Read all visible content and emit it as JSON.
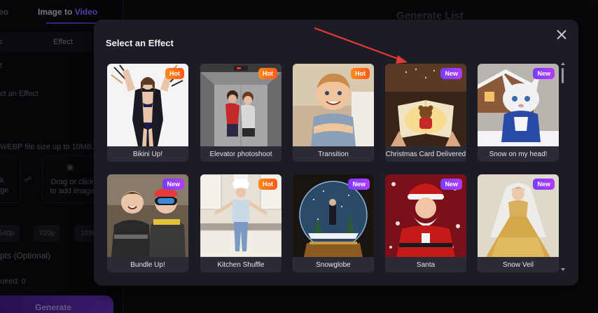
{
  "background": {
    "tabs": [
      "eo",
      "Image to ",
      "Video"
    ],
    "subtabs": [
      "s",
      "Effect"
    ],
    "labels": [
      "t",
      "ct an Effect",
      "WEBP file size up to 10MB.",
      "k",
      "ge",
      "Drag or click to add image",
      "pts (Optional)",
      "uired: 0"
    ],
    "resolutions": [
      "540p",
      "720p",
      "1080"
    ],
    "right_title": "Generate List",
    "generate_button": "Generate"
  },
  "modal": {
    "title": "Select an Effect",
    "close_icon": "close-icon",
    "effects": [
      {
        "label": "Bikini Up!",
        "badge": "Hot"
      },
      {
        "label": "Elevator photoshoot",
        "badge": "Hot"
      },
      {
        "label": "Transition",
        "badge": "Hot"
      },
      {
        "label": "Christmas Card Delivered",
        "badge": "New"
      },
      {
        "label": "Snow on my head!",
        "badge": "New"
      },
      {
        "label": "Bundle Up!",
        "badge": "New"
      },
      {
        "label": "Kitchen Shuffle",
        "badge": "Hot"
      },
      {
        "label": "Snowglobe",
        "badge": "New"
      },
      {
        "label": "Santa",
        "badge": "New"
      },
      {
        "label": "Snow Veil",
        "badge": "New"
      }
    ]
  },
  "annotation": {
    "arrow_color": "#e53935"
  },
  "colors": {
    "hot": "#ff7a1a",
    "new": "#8a3cff",
    "modal_bg": "#1c1c24",
    "accent": "#6c4cff"
  }
}
